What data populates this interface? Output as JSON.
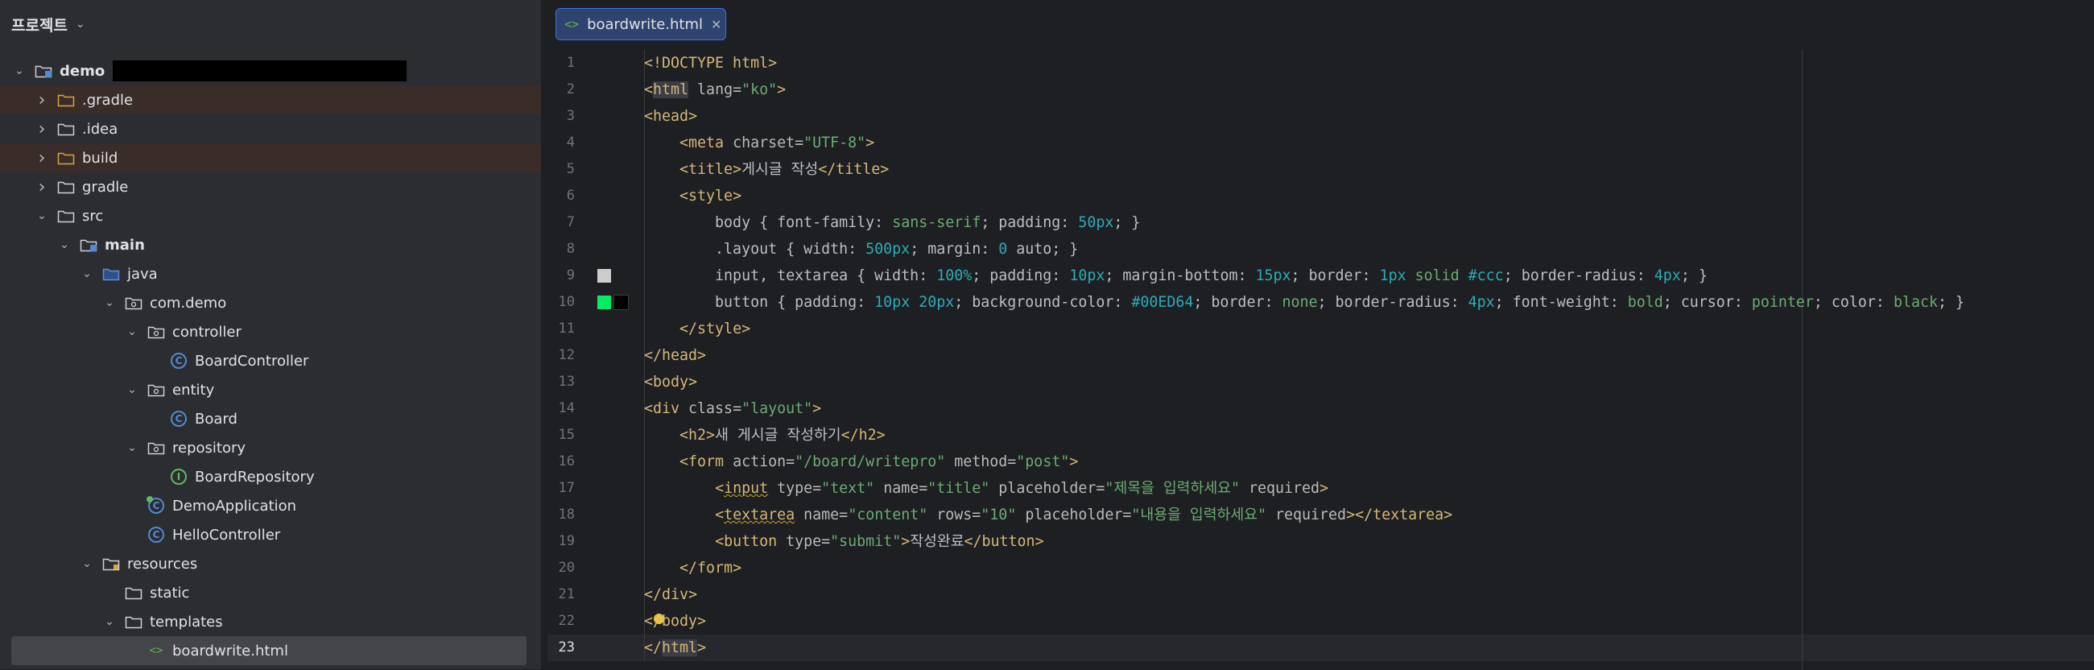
{
  "project_panel": {
    "title": "프로젝트",
    "tree": [
      {
        "label": "demo",
        "depth": 0,
        "expanded": true,
        "icon": "module-folder-icon",
        "bold": true,
        "redacted_suffix": true
      },
      {
        "label": ".gradle",
        "depth": 1,
        "expanded": false,
        "icon": "folder-excluded-icon",
        "highlight": true
      },
      {
        "label": ".idea",
        "depth": 1,
        "expanded": false,
        "icon": "folder-icon"
      },
      {
        "label": "build",
        "depth": 1,
        "expanded": false,
        "icon": "folder-excluded-icon",
        "highlight": true
      },
      {
        "label": "gradle",
        "depth": 1,
        "expanded": false,
        "icon": "folder-icon"
      },
      {
        "label": "src",
        "depth": 1,
        "expanded": true,
        "icon": "folder-icon"
      },
      {
        "label": "main",
        "depth": 2,
        "expanded": true,
        "icon": "module-folder-icon",
        "bold": true
      },
      {
        "label": "java",
        "depth": 3,
        "expanded": true,
        "icon": "source-folder-icon"
      },
      {
        "label": "com.demo",
        "depth": 4,
        "expanded": true,
        "icon": "package-icon"
      },
      {
        "label": "controller",
        "depth": 5,
        "expanded": true,
        "icon": "package-icon"
      },
      {
        "label": "BoardController",
        "depth": 6,
        "icon": "class-icon"
      },
      {
        "label": "entity",
        "depth": 5,
        "expanded": true,
        "icon": "package-icon"
      },
      {
        "label": "Board",
        "depth": 6,
        "icon": "class-icon"
      },
      {
        "label": "repository",
        "depth": 5,
        "expanded": true,
        "icon": "package-icon"
      },
      {
        "label": "BoardRepository",
        "depth": 6,
        "icon": "interface-icon"
      },
      {
        "label": "DemoApplication",
        "depth": 5,
        "icon": "spring-class-icon"
      },
      {
        "label": "HelloController",
        "depth": 5,
        "icon": "class-icon"
      },
      {
        "label": "resources",
        "depth": 3,
        "expanded": true,
        "icon": "resources-folder-icon"
      },
      {
        "label": "static",
        "depth": 4,
        "expanded": false,
        "icon": "folder-icon",
        "leaf": true
      },
      {
        "label": "templates",
        "depth": 4,
        "expanded": true,
        "icon": "folder-icon"
      },
      {
        "label": "boardwrite.html",
        "depth": 5,
        "icon": "html-file-icon",
        "selected": true
      }
    ]
  },
  "tab": {
    "label": "boardwrite.html",
    "icon": "html-file-icon"
  },
  "editor": {
    "current_line": 23,
    "lines": [
      [
        [
          "tag",
          "<!DOCTYPE html>"
        ]
      ],
      [
        [
          "tag",
          "<"
        ],
        [
          "tag htmlbg",
          "html"
        ],
        [
          "attr",
          " lang="
        ],
        [
          "str",
          "\"ko\""
        ],
        [
          "tag",
          ">"
        ]
      ],
      [
        [
          "tag",
          "<head>"
        ]
      ],
      [
        [
          "t",
          "    "
        ],
        [
          "tag",
          "<meta"
        ],
        [
          "attr",
          " charset="
        ],
        [
          "str",
          "\"UTF-8\""
        ],
        [
          "tag",
          ">"
        ]
      ],
      [
        [
          "t",
          "    "
        ],
        [
          "tag",
          "<title>"
        ],
        [
          "ctext",
          "게시글 작성"
        ],
        [
          "tag",
          "</title>"
        ]
      ],
      [
        [
          "t",
          "    "
        ],
        [
          "tag",
          "<style>"
        ]
      ],
      [
        [
          "t",
          "        body { font-family: "
        ],
        [
          "str",
          "sans-serif"
        ],
        [
          "t",
          "; padding: "
        ],
        [
          "num",
          "50px"
        ],
        [
          "t",
          "; }"
        ]
      ],
      [
        [
          "t",
          "        .layout { width: "
        ],
        [
          "num",
          "500px"
        ],
        [
          "t",
          "; margin: "
        ],
        [
          "num",
          "0"
        ],
        [
          "t",
          " auto; }"
        ]
      ],
      [
        [
          "t",
          "        input, textarea { width: "
        ],
        [
          "num",
          "100%"
        ],
        [
          "t",
          "; padding: "
        ],
        [
          "num",
          "10px"
        ],
        [
          "t",
          "; margin-bottom: "
        ],
        [
          "num",
          "15px"
        ],
        [
          "t",
          "; border: "
        ],
        [
          "num",
          "1px"
        ],
        [
          "str",
          " solid"
        ],
        [
          "t",
          " "
        ],
        [
          "num",
          "#ccc"
        ],
        [
          "t",
          "; border-radius: "
        ],
        [
          "num",
          "4px"
        ],
        [
          "t",
          "; }"
        ]
      ],
      [
        [
          "t",
          "        button { padding: "
        ],
        [
          "num",
          "10px 20px"
        ],
        [
          "t",
          "; background-color: "
        ],
        [
          "num",
          "#00ED64"
        ],
        [
          "t",
          "; border: "
        ],
        [
          "str",
          "none"
        ],
        [
          "t",
          "; border-radius: "
        ],
        [
          "num",
          "4px"
        ],
        [
          "t",
          "; font-weight: "
        ],
        [
          "str",
          "bold"
        ],
        [
          "t",
          "; cursor: "
        ],
        [
          "str",
          "pointer"
        ],
        [
          "t",
          "; color: "
        ],
        [
          "str",
          "black"
        ],
        [
          "t",
          "; }"
        ]
      ],
      [
        [
          "t",
          "    "
        ],
        [
          "tag",
          "</style>"
        ]
      ],
      [
        [
          "tag",
          "</head>"
        ]
      ],
      [
        [
          "tag",
          "<body>"
        ]
      ],
      [
        [
          "tag",
          "<div"
        ],
        [
          "attr",
          " class="
        ],
        [
          "str",
          "\"layout\""
        ],
        [
          "tag",
          ">"
        ]
      ],
      [
        [
          "t",
          "    "
        ],
        [
          "tag",
          "<h2>"
        ],
        [
          "ctext",
          "새 게시글 작성하기"
        ],
        [
          "tag",
          "</h2>"
        ]
      ],
      [
        [
          "t",
          "    "
        ],
        [
          "tag",
          "<form"
        ],
        [
          "attr",
          " action="
        ],
        [
          "str",
          "\"/board/writepro\""
        ],
        [
          "attr",
          " method="
        ],
        [
          "str",
          "\"post\""
        ],
        [
          "tag",
          ">"
        ]
      ],
      [
        [
          "t",
          "        "
        ],
        [
          "tag",
          "<"
        ],
        [
          "tag ul",
          "input"
        ],
        [
          "attr",
          " type="
        ],
        [
          "str",
          "\"text\""
        ],
        [
          "attr",
          " name="
        ],
        [
          "str",
          "\"title\""
        ],
        [
          "attr",
          " placeholder="
        ],
        [
          "str",
          "\"제목을 입력하세요\""
        ],
        [
          "attr",
          " required"
        ],
        [
          "tag",
          ">"
        ]
      ],
      [
        [
          "t",
          "        "
        ],
        [
          "tag",
          "<"
        ],
        [
          "tag ul",
          "textarea"
        ],
        [
          "attr",
          " name="
        ],
        [
          "str",
          "\"content\""
        ],
        [
          "attr",
          " rows="
        ],
        [
          "str",
          "\"10\""
        ],
        [
          "attr",
          " placeholder="
        ],
        [
          "str",
          "\"내용을 입력하세요\""
        ],
        [
          "attr",
          " required"
        ],
        [
          "tag",
          "></textarea>"
        ]
      ],
      [
        [
          "t",
          "        "
        ],
        [
          "tag",
          "<button"
        ],
        [
          "attr",
          " type="
        ],
        [
          "str",
          "\"submit\""
        ],
        [
          "tag",
          ">"
        ],
        [
          "ctext",
          "작성완료"
        ],
        [
          "tag",
          "</button>"
        ]
      ],
      [
        [
          "t",
          "    "
        ],
        [
          "tag",
          "</form>"
        ]
      ],
      [
        [
          "tag",
          "</div>"
        ]
      ],
      [
        [
          "tag",
          "</body>"
        ]
      ],
      [
        [
          "tag",
          "</"
        ],
        [
          "tag endbg",
          "html"
        ],
        [
          "tag",
          ">"
        ]
      ]
    ],
    "color_swatches": [
      {
        "line": 9,
        "color": "#cccccc"
      },
      {
        "line": 10,
        "color": "#00ED64"
      },
      {
        "line": 10,
        "color": "#000000"
      }
    ]
  }
}
